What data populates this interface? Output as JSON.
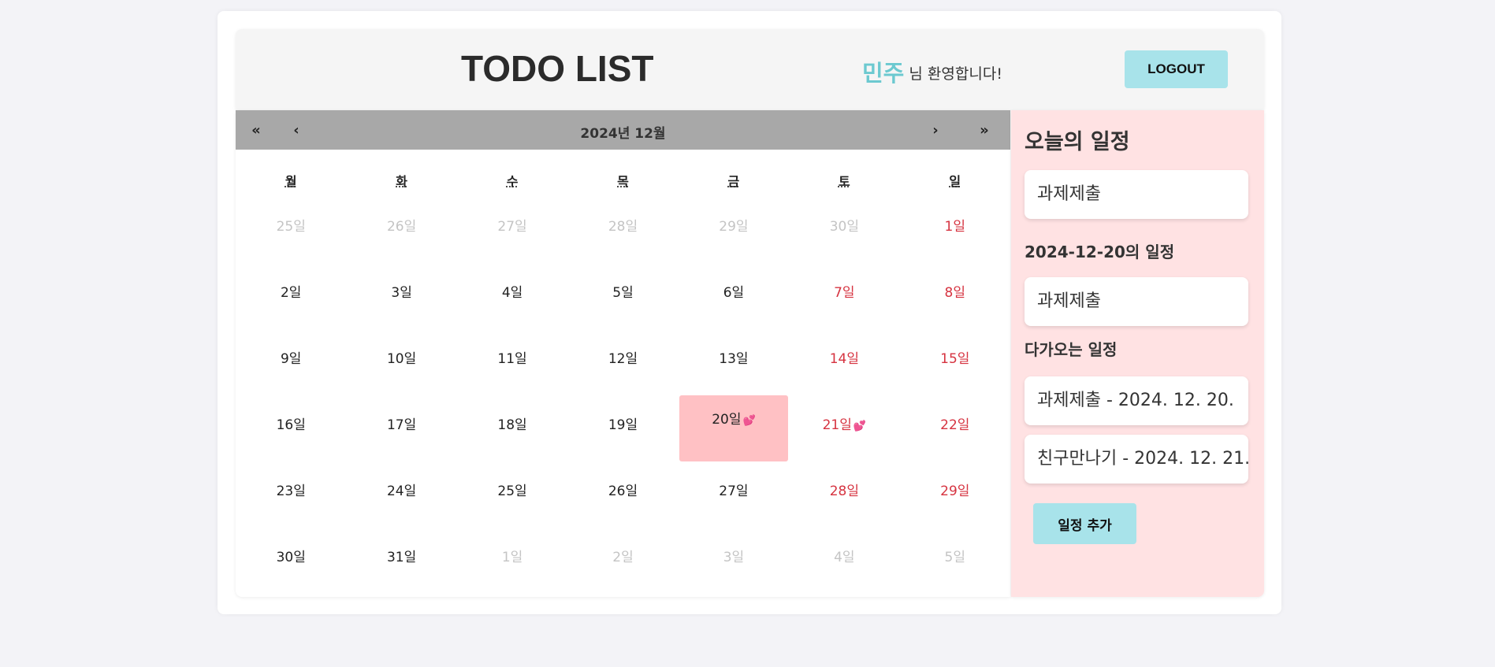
{
  "header": {
    "title": "TODO LIST",
    "username": "민주",
    "welcome_suffix": " 님 환영합니다!",
    "logout_label": "LOGOUT"
  },
  "calendar": {
    "month_label": "2024년 12월",
    "nav": {
      "prev_year": "«",
      "prev_month": "‹",
      "next_month": "›",
      "next_year": "»"
    },
    "weekdays": [
      "월",
      "화",
      "수",
      "목",
      "금",
      "토",
      "일"
    ],
    "days": [
      {
        "label": "25일",
        "kind": "other"
      },
      {
        "label": "26일",
        "kind": "other"
      },
      {
        "label": "27일",
        "kind": "other"
      },
      {
        "label": "28일",
        "kind": "other"
      },
      {
        "label": "29일",
        "kind": "other"
      },
      {
        "label": "30일",
        "kind": "other"
      },
      {
        "label": "1일",
        "kind": "weekend"
      },
      {
        "label": "2일",
        "kind": "normal"
      },
      {
        "label": "3일",
        "kind": "normal"
      },
      {
        "label": "4일",
        "kind": "normal"
      },
      {
        "label": "5일",
        "kind": "normal"
      },
      {
        "label": "6일",
        "kind": "normal"
      },
      {
        "label": "7일",
        "kind": "weekend"
      },
      {
        "label": "8일",
        "kind": "weekend"
      },
      {
        "label": "9일",
        "kind": "normal"
      },
      {
        "label": "10일",
        "kind": "normal"
      },
      {
        "label": "11일",
        "kind": "normal"
      },
      {
        "label": "12일",
        "kind": "normal"
      },
      {
        "label": "13일",
        "kind": "normal"
      },
      {
        "label": "14일",
        "kind": "weekend"
      },
      {
        "label": "15일",
        "kind": "weekend"
      },
      {
        "label": "16일",
        "kind": "normal"
      },
      {
        "label": "17일",
        "kind": "normal"
      },
      {
        "label": "18일",
        "kind": "normal"
      },
      {
        "label": "19일",
        "kind": "normal"
      },
      {
        "label": "20일",
        "kind": "normal",
        "selected": true,
        "has_todo": true
      },
      {
        "label": "21일",
        "kind": "weekend",
        "has_todo": true
      },
      {
        "label": "22일",
        "kind": "weekend"
      },
      {
        "label": "23일",
        "kind": "normal"
      },
      {
        "label": "24일",
        "kind": "normal"
      },
      {
        "label": "25일",
        "kind": "normal"
      },
      {
        "label": "26일",
        "kind": "normal"
      },
      {
        "label": "27일",
        "kind": "normal"
      },
      {
        "label": "28일",
        "kind": "weekend"
      },
      {
        "label": "29일",
        "kind": "weekend"
      },
      {
        "label": "30일",
        "kind": "normal"
      },
      {
        "label": "31일",
        "kind": "normal"
      },
      {
        "label": "1일",
        "kind": "other"
      },
      {
        "label": "2일",
        "kind": "other"
      },
      {
        "label": "3일",
        "kind": "other"
      },
      {
        "label": "4일",
        "kind": "other"
      },
      {
        "label": "5일",
        "kind": "other"
      }
    ],
    "todo_marker_icon": "two-hearts-icon"
  },
  "sidebar": {
    "today_title": "오늘의 일정",
    "today_items": [
      "과제제출"
    ],
    "selected_date_title": "2024-12-20의 일정",
    "selected_items": [
      "과제제출"
    ],
    "upcoming_title": "다가오는 일정",
    "upcoming_items": [
      "과제제출 - 2024. 12. 20.",
      "친구만나기 - 2024. 12. 21."
    ],
    "add_label": "일정 추가"
  },
  "colors": {
    "accent": "#a8e3ea",
    "username": "#6cc9d0",
    "weekend": "#d63340",
    "selected_day": "#ffc1c4",
    "sidebar_bg": "#ffe2e3",
    "nav_bg": "#a8a8a8"
  }
}
